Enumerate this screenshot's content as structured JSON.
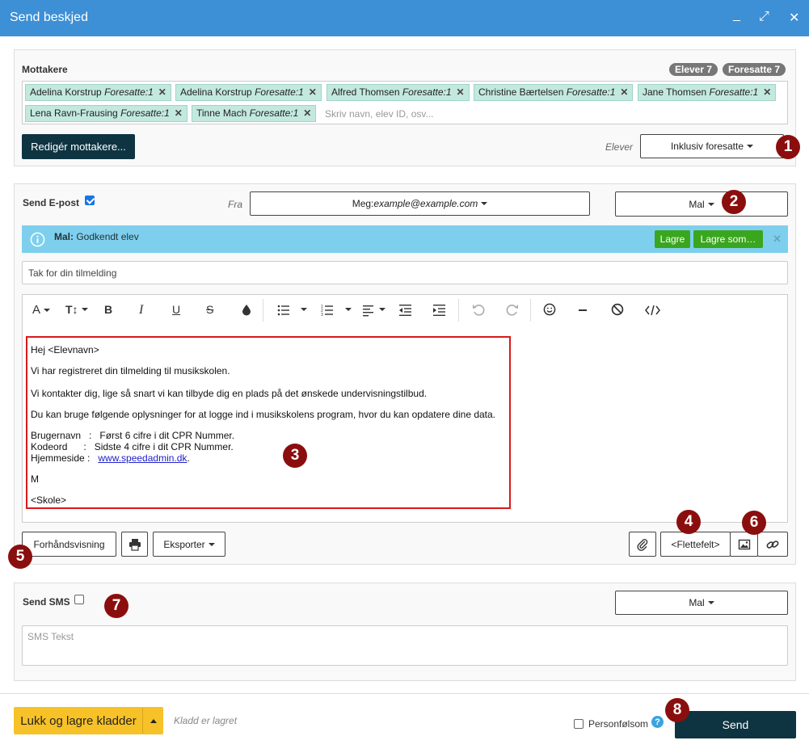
{
  "window": {
    "title": "Send beskjed",
    "minimize": "_",
    "maximize": "⤢",
    "close": "✕"
  },
  "recipients": {
    "label": "Mottakere",
    "badge_students": "Elever 7",
    "badge_parents": "Foresatte 7",
    "chips": [
      {
        "name": "Adelina Korstrup",
        "role": "Foresatte:1"
      },
      {
        "name": "Adelina Korstrup",
        "role": "Foresatte:1"
      },
      {
        "name": "Alfred Thomsen",
        "role": "Foresatte:1"
      },
      {
        "name": "Christine Bærtelsen",
        "role": "Foresatte:1"
      },
      {
        "name": "Jane Thomsen",
        "role": "Foresatte:1"
      },
      {
        "name": "Lena Ravn-Frausing",
        "role": "Foresatte:1"
      },
      {
        "name": "Tinne Mach",
        "role": "Foresatte:1"
      }
    ],
    "chip_remove": "✕",
    "search_placeholder": "Skriv navn, elev ID, osv...",
    "edit_button": "Redigér mottakere...",
    "students_label": "Elever",
    "include_dropdown": "Inklusiv foresatte"
  },
  "email": {
    "label": "Send E-post",
    "from_label": "Fra",
    "from_prefix": "Meg: ",
    "from_value": "example@example.com",
    "template_dropdown": "Mal",
    "info_label": "Mal:",
    "info_value": "Godkendt elev",
    "save_button": "Lagre",
    "save_as_button": "Lagre som…",
    "info_close": "✕",
    "subject": "Tak for din tilmelding",
    "body": {
      "greeting": "Hej <Elevnavn>",
      "line1": "Vi har registreret din tilmelding til musikskolen.",
      "line2": "Vi kontakter dig, lige så snart vi kan tilbyde dig en plads på det ønskede undervisningstilbud.",
      "line3": "Du kan bruge følgende oplysninger for at logge ind i musikskolens program, hvor du kan opdatere dine data.",
      "username_row": "Brugernavn   :   Først 6 cifre i dit CPR Nummer.",
      "password_row": "Kodeord      :   Sidste 4 cifre i dit CPR Nummer.",
      "homepage_label": "Hjemmeside :   ",
      "homepage_link": "www.speedadmin.dk",
      "homepage_suffix": ".",
      "sign": "M",
      "school": "<Skole>"
    },
    "preview_button": "Forhåndsvisning",
    "export_button": "Eksporter",
    "merge_field_button": "<Flettefelt>"
  },
  "toolbar": {
    "font": "A",
    "size": "T↕",
    "bold": "B",
    "italic": "I",
    "underline": "U",
    "strike": "S"
  },
  "sms": {
    "label": "Send SMS",
    "template_dropdown": "Mal",
    "placeholder": "SMS Tekst"
  },
  "footer": {
    "close_save_button": "Lukk og lagre kladder",
    "draft_status": "Kladd er lagret",
    "sensitive_label": "Personfølsom",
    "help": "?",
    "send_button": "Send"
  },
  "markers": [
    "1",
    "2",
    "3",
    "4",
    "5",
    "6",
    "7",
    "8"
  ],
  "colors": {
    "titlebar": "#3d8fd6",
    "dark_button": "#0e3442",
    "marker": "#8b0e0e",
    "chip": "#c3e9df",
    "info": "#7ecfee",
    "green": "#3aa61e",
    "yellow": "#f7c227"
  }
}
